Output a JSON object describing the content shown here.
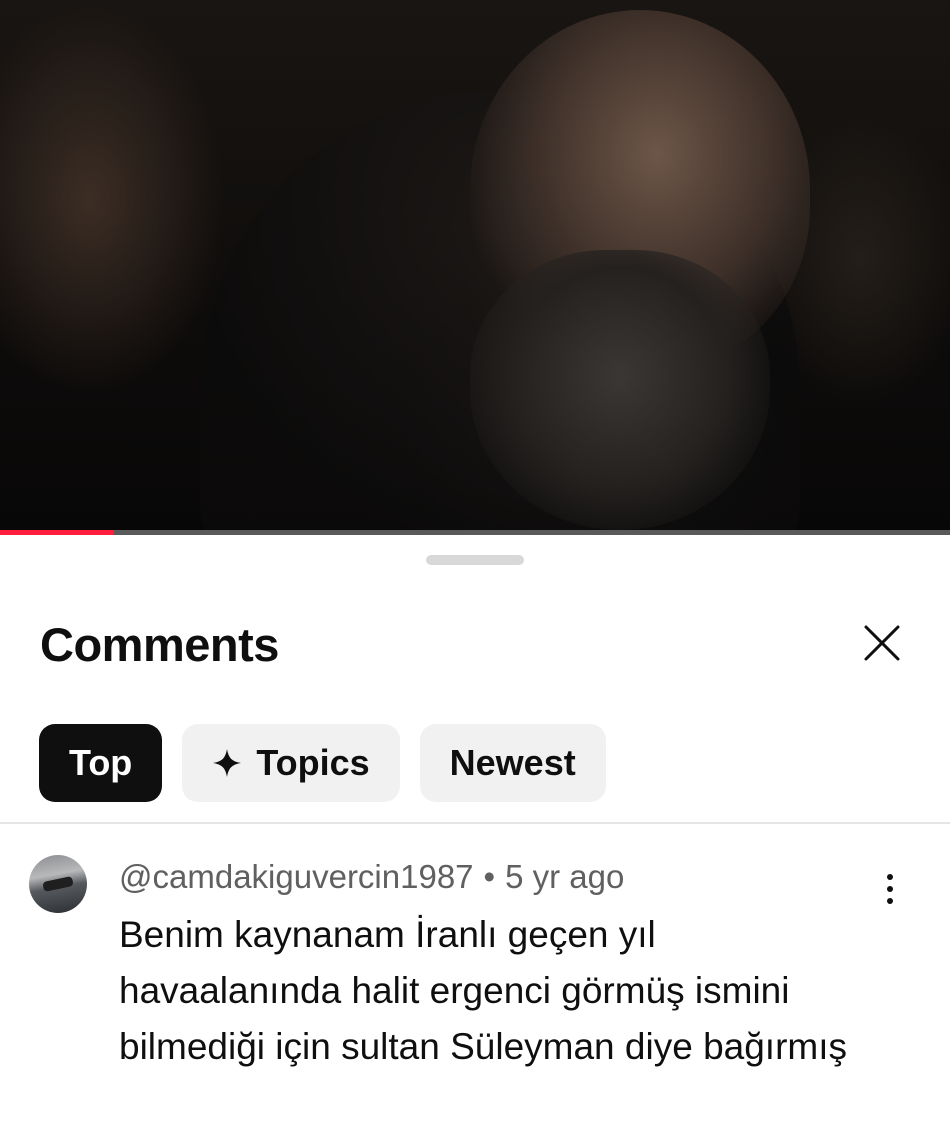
{
  "video": {
    "progress_fraction": 0.12,
    "progress_color": "#ff1f3d"
  },
  "sheet": {
    "title": "Comments",
    "close_icon": "close-icon",
    "tabs": [
      {
        "label": "Top",
        "active": true
      },
      {
        "label": "Topics",
        "icon": "sparkle-icon",
        "active": false
      },
      {
        "label": "Newest",
        "active": false
      }
    ]
  },
  "comments": [
    {
      "author": "@camdakiguvercin1987",
      "separator": "•",
      "time": "5 yr ago",
      "text": "Benim kaynanam İranlı geçen yıl havaalanında halit ergenci görmüş ismini bilmediği için sultan Süleyman diye bağırmış"
    }
  ]
}
